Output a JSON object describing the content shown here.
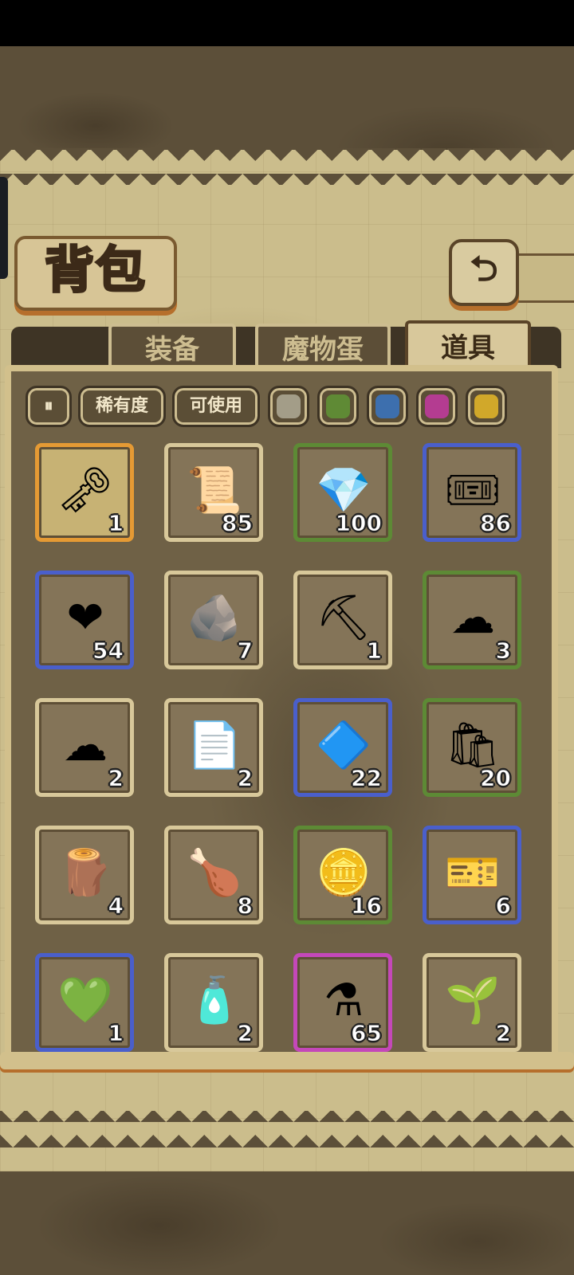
{
  "header": {
    "title": "背包",
    "back_icon": "⮌"
  },
  "tabs": [
    {
      "label": "装备",
      "active": false
    },
    {
      "label": "魔物蛋",
      "active": false
    },
    {
      "label": "道具",
      "active": true
    }
  ],
  "filters": {
    "sort_icon": "⏸",
    "rarity_label": "稀有度",
    "usable_label": "可使用",
    "swatches": [
      "#a39d88",
      "#5f8a35",
      "#3d6fae",
      "#b43c91",
      "#d1a82a"
    ]
  },
  "items": [
    {
      "icon": "🗝",
      "count": "1",
      "rarity": "orange"
    },
    {
      "icon": "📜",
      "count": "85",
      "rarity": "plain"
    },
    {
      "icon": "💎",
      "count": "100",
      "rarity": "green"
    },
    {
      "icon": "🎟",
      "count": "86",
      "rarity": "blue"
    },
    {
      "icon": "❤",
      "count": "54",
      "rarity": "blue"
    },
    {
      "icon": "🪨",
      "count": "7",
      "rarity": "plain"
    },
    {
      "icon": "⛏",
      "count": "1",
      "rarity": "plain"
    },
    {
      "icon": "☁",
      "count": "3",
      "rarity": "green"
    },
    {
      "icon": "☁",
      "count": "2",
      "rarity": "plain"
    },
    {
      "icon": "📄",
      "count": "2",
      "rarity": "plain"
    },
    {
      "icon": "🔷",
      "count": "22",
      "rarity": "blue"
    },
    {
      "icon": "🛍",
      "count": "20",
      "rarity": "green"
    },
    {
      "icon": "🪵",
      "count": "4",
      "rarity": "plain"
    },
    {
      "icon": "🍗",
      "count": "8",
      "rarity": "plain"
    },
    {
      "icon": "🪙",
      "count": "16",
      "rarity": "green"
    },
    {
      "icon": "🎫",
      "count": "6",
      "rarity": "blue"
    },
    {
      "icon": "💚",
      "count": "1",
      "rarity": "blue"
    },
    {
      "icon": "🧴",
      "count": "2",
      "rarity": "plain"
    },
    {
      "icon": "⚗",
      "count": "65",
      "rarity": "purple"
    },
    {
      "icon": "🌱",
      "count": "2",
      "rarity": "plain"
    }
  ]
}
